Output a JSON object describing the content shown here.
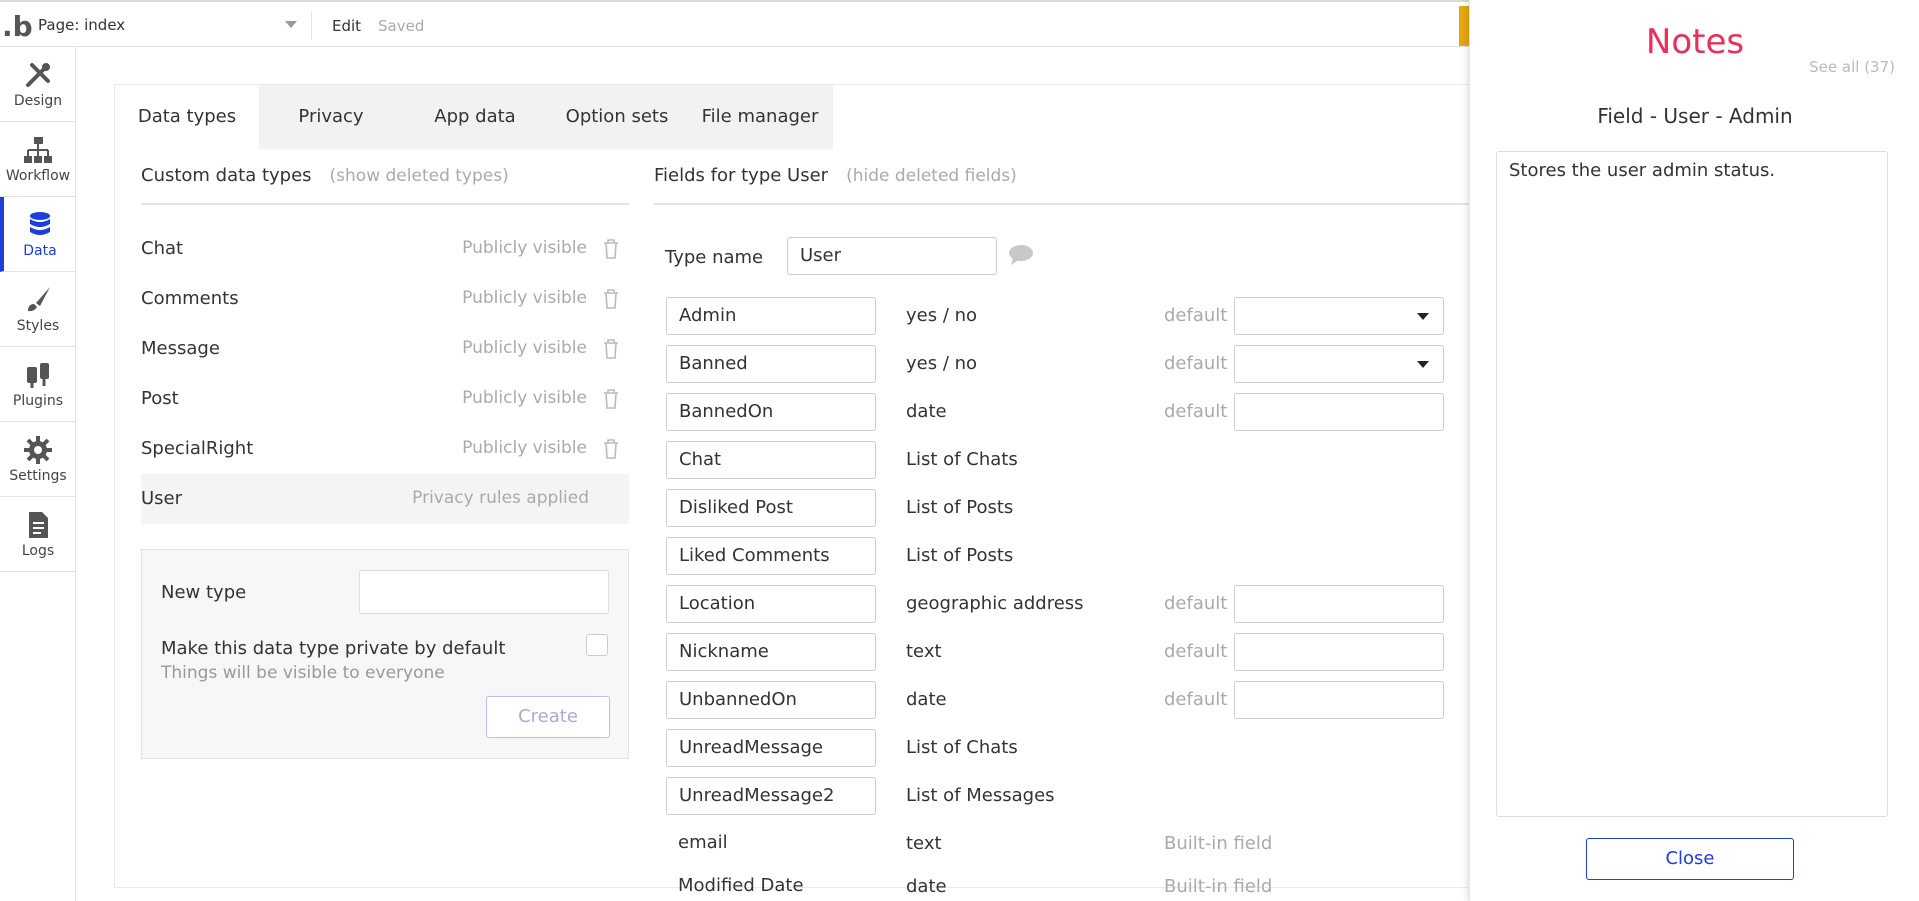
{
  "topbar": {
    "logo": ".b",
    "page_label": "Page: index",
    "edit_label": "Edit",
    "saved_label": "Saved"
  },
  "sidenav": {
    "items": [
      {
        "label": "Design",
        "icon": "design-icon"
      },
      {
        "label": "Workflow",
        "icon": "workflow-icon"
      },
      {
        "label": "Data",
        "icon": "database-icon",
        "active": true
      },
      {
        "label": "Styles",
        "icon": "brush-icon"
      },
      {
        "label": "Plugins",
        "icon": "plug-icon"
      },
      {
        "label": "Settings",
        "icon": "gear-icon"
      },
      {
        "label": "Logs",
        "icon": "document-icon"
      }
    ]
  },
  "tabs": [
    "Data types",
    "Privacy",
    "App data",
    "Option sets",
    "File manager"
  ],
  "custom_types": {
    "title": "Custom data types",
    "toggle": "(show deleted types)",
    "rows": [
      {
        "name": "Chat",
        "visibility": "Publicly visible"
      },
      {
        "name": "Comments",
        "visibility": "Publicly visible"
      },
      {
        "name": "Message",
        "visibility": "Publicly visible"
      },
      {
        "name": "Post",
        "visibility": "Publicly visible"
      },
      {
        "name": "SpecialRight",
        "visibility": "Publicly visible"
      },
      {
        "name": "User",
        "visibility": "Privacy rules applied"
      }
    ]
  },
  "new_type": {
    "label": "New type",
    "private_label": "Make this data type private by default",
    "private_sub": "Things will be visible to everyone",
    "create_label": "Create"
  },
  "fields": {
    "title": "Fields for type User",
    "toggle": "(hide deleted fields)",
    "type_name_label": "Type name",
    "type_name_value": "User",
    "default_label": "default",
    "builtin_label": "Built-in field",
    "rows": [
      {
        "name": "Admin",
        "type": "yes / no",
        "default": "dropdown"
      },
      {
        "name": "Banned",
        "type": "yes / no",
        "default": "dropdown"
      },
      {
        "name": "BannedOn",
        "type": "date",
        "default": "input"
      },
      {
        "name": "Chat",
        "type": "List of Chats",
        "default": "none"
      },
      {
        "name": "Disliked Post",
        "type": "List of Posts",
        "default": "none"
      },
      {
        "name": "Liked Comments",
        "type": "List of Posts",
        "default": "none"
      },
      {
        "name": "Location",
        "type": "geographic address",
        "default": "input"
      },
      {
        "name": "Nickname",
        "type": "text",
        "default": "input"
      },
      {
        "name": "UnbannedOn",
        "type": "date",
        "default": "input"
      },
      {
        "name": "UnreadMessage",
        "type": "List of Chats",
        "default": "none"
      },
      {
        "name": "UnreadMessage2",
        "type": "List of Messages",
        "default": "none"
      },
      {
        "name": "email",
        "type": "text",
        "default": "builtin"
      },
      {
        "name": "Modified Date",
        "type": "date",
        "default": "builtin"
      }
    ]
  },
  "notes": {
    "title": "Notes",
    "see_all": "See all (37)",
    "subtitle": "Field - User - Admin",
    "text": "Stores the user admin status.",
    "close_label": "Close"
  },
  "colors": {
    "accent_blue": "#1d3ed8",
    "notes_title": "#e8305a",
    "muted_text": "#aaaaaa"
  }
}
